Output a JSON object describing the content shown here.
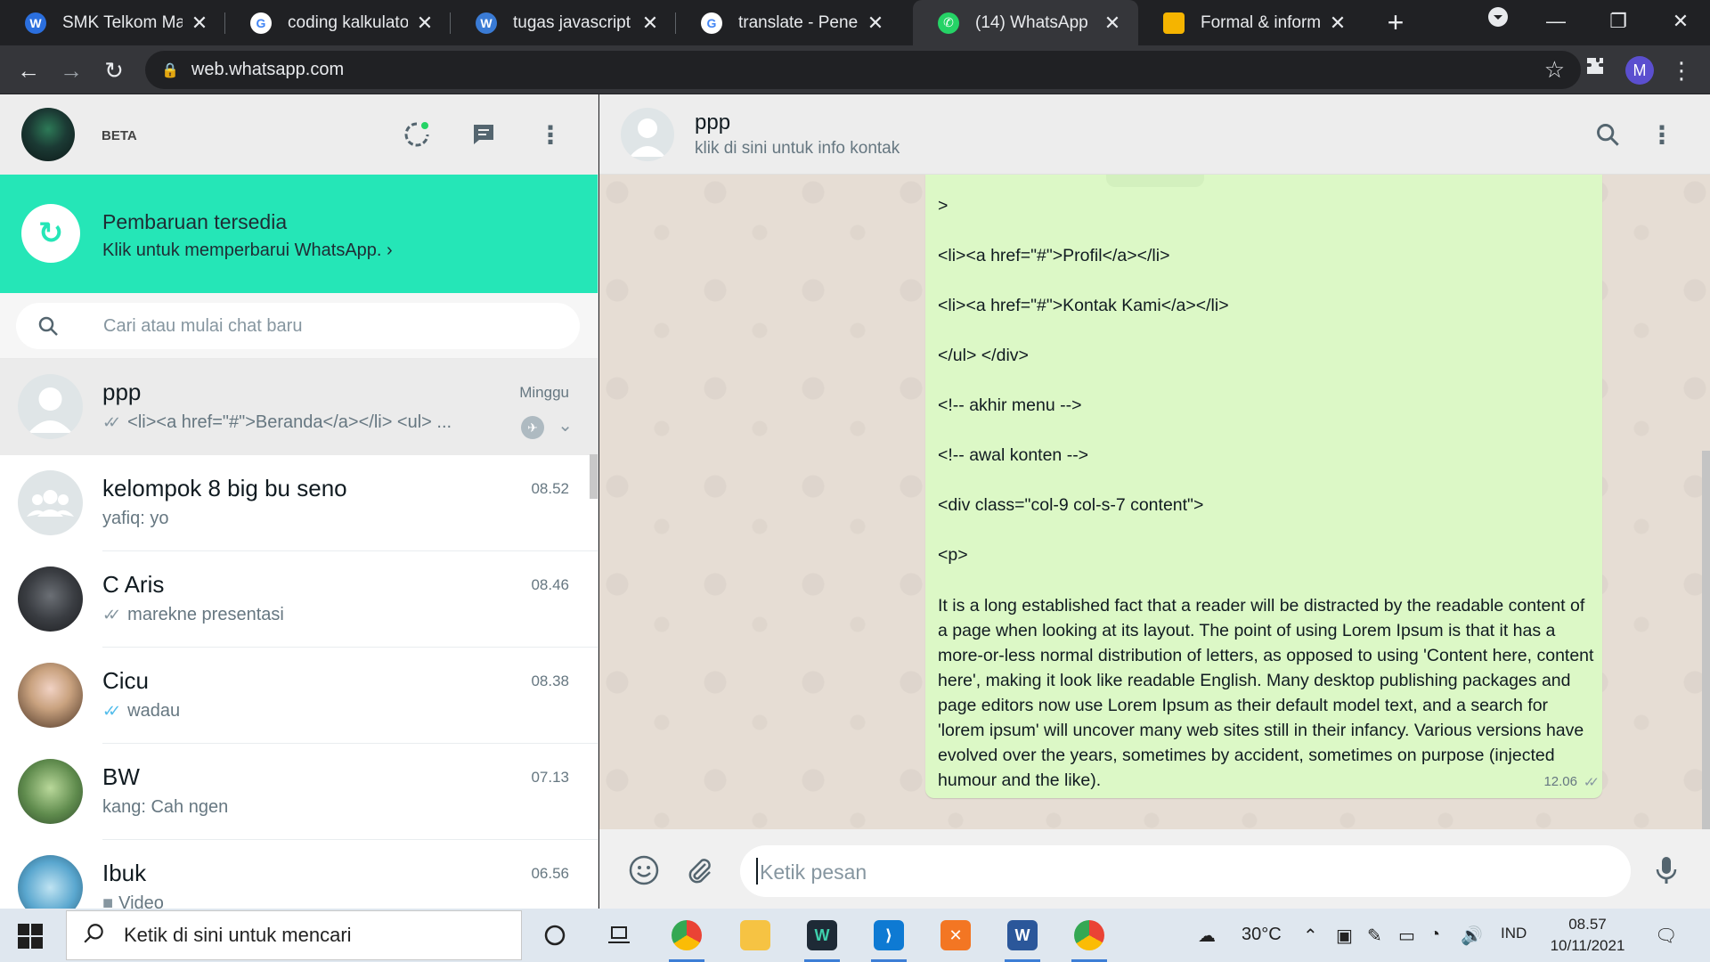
{
  "browser": {
    "tabs": [
      {
        "title": "SMK Telkom Malang",
        "icon": "webex-icon",
        "color": "#2b6fde"
      },
      {
        "title": "coding kalkulator ja",
        "icon": "google-icon",
        "color": "#ffffff"
      },
      {
        "title": "tugas javascript | Kit",
        "icon": "wordpress-icon",
        "color": "#3a7bd5"
      },
      {
        "title": "translate - Penelusu",
        "icon": "google-icon",
        "color": "#ffffff"
      },
      {
        "title": "(14) WhatsApp",
        "icon": "whatsapp-icon",
        "color": "#25d366",
        "active": true
      },
      {
        "title": "Formal & informal i",
        "icon": "slides-icon",
        "color": "#f5b400"
      }
    ],
    "url": "web.whatsapp.com",
    "profile_initial": "M"
  },
  "sidebar": {
    "beta_label": "BETA",
    "update_title": "Pembaruan tersedia",
    "update_subtitle": "Klik untuk memperbarui WhatsApp. ›",
    "search_placeholder": "Cari atau mulai chat baru",
    "chats": [
      {
        "name": "ppp",
        "time": "Minggu",
        "preview": "<li><a href=\"#\">Beranda</a></li> <ul> ...",
        "tick": "grey",
        "selected": true,
        "pinned": true
      },
      {
        "name": "kelompok 8 big bu seno",
        "time": "08.52",
        "preview": "yafiq: yo",
        "tick": "none"
      },
      {
        "name": "C Aris",
        "time": "08.46",
        "preview": "marekne presentasi",
        "tick": "grey"
      },
      {
        "name": "Cicu",
        "time": "08.38",
        "preview": "wadau",
        "tick": "blue"
      },
      {
        "name": "BW",
        "time": "07.13",
        "preview": "kang: Cah ngen",
        "tick": "none"
      },
      {
        "name": "Ibuk",
        "time": "06.56",
        "preview": "Video",
        "tick": "video"
      }
    ]
  },
  "conversation": {
    "contact_name": "ppp",
    "contact_info": "klik di sini untuk info kontak",
    "message_lines": [
      ">",
      "<li><a href=\"#\">Profil</a></li>",
      "<li><a href=\"#\">Kontak Kami</a></li>",
      "</ul> </div>",
      "<!-- akhir menu -->",
      "<!-- awal konten -->",
      "<div class=\"col-9 col-s-7 content\">",
      "<p>"
    ],
    "message_paragraph": "It is a long established fact that a reader will be distracted by the readable content of a page when looking at its layout. The point of using Lorem Ipsum is that it has a more-or-less normal distribution of letters, as opposed to using 'Content here, content here', making it look like readable English. Many desktop publishing packages and page editors now use Lorem Ipsum as their default model text, and a search for 'lorem ipsum' will uncover many web sites still in their infancy. Various versions have evolved over the years, sometimes by accident, sometimes on purpose (injected humour and the like).",
    "message_time": "12.06",
    "compose_placeholder": "Ketik pesan"
  },
  "taskbar": {
    "search_placeholder": "Ketik di sini untuk mencari",
    "weather": "30°C",
    "language": "IND",
    "time": "08.57",
    "date": "10/11/2021"
  },
  "colors": {
    "update_banner": "#25e6b7",
    "bubble_out": "#dcf8c6",
    "tick_blue": "#53bdeb"
  }
}
